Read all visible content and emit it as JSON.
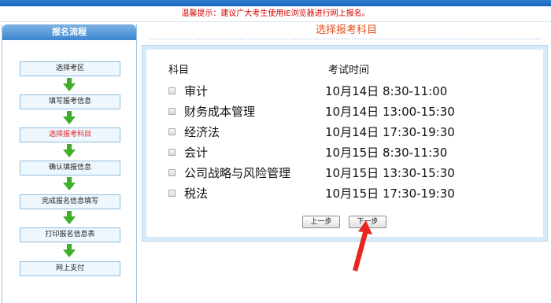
{
  "notice": "温馨提示：建议广大考生使用IE浏览器进行网上报名。",
  "sidebar": {
    "title": "报名流程",
    "steps": [
      {
        "label": "选择考区"
      },
      {
        "label": "填写报考信息"
      },
      {
        "label": "选择报考科目",
        "active": true
      },
      {
        "label": "确认填报信息"
      },
      {
        "label": "完成报名信息填写"
      },
      {
        "label": "打印报名信息表"
      },
      {
        "label": "网上支付"
      }
    ]
  },
  "main": {
    "title": "选择报考科目",
    "headers": {
      "subject": "科目",
      "time": "考试时间"
    },
    "subjects": [
      {
        "name": "审计",
        "time": "10月14日 8:30-11:00",
        "checked": false
      },
      {
        "name": "财务成本管理",
        "time": "10月14日 13:00-15:30",
        "checked": false
      },
      {
        "name": "经济法",
        "time": "10月14日 17:30-19:30",
        "checked": false
      },
      {
        "name": "会计",
        "time": "10月15日 8:30-11:30",
        "checked": false
      },
      {
        "name": "公司战略与风险管理",
        "time": "10月15日 13:30-15:30",
        "checked": false
      },
      {
        "name": "税法",
        "time": "10月15日 17:30-19:30",
        "checked": false
      }
    ],
    "buttons": {
      "prev": "上一步",
      "next": "下一步"
    }
  },
  "colors": {
    "accent_blue": "#3c86cf",
    "title_orange": "#e0521c",
    "notice_red": "#d40000",
    "arrow_green": "#3fae29",
    "annotation_red": "#e8261f"
  }
}
